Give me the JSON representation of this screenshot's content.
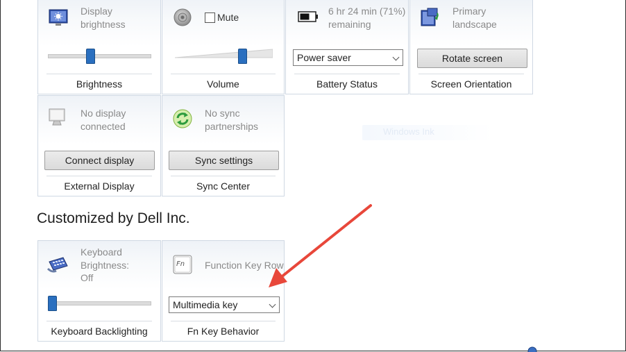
{
  "tiles": {
    "brightness": {
      "status_line1": "Display",
      "status_line2": "brightness",
      "caption": "Brightness",
      "slider_level": 0.41
    },
    "volume": {
      "mute_label": "Mute",
      "mute_checked": false,
      "caption": "Volume",
      "slider_level": 0.7
    },
    "battery": {
      "status_line1": "6 hr 24 min (71%)",
      "status_line2": "remaining",
      "dropdown_value": "Power saver",
      "caption": "Battery Status"
    },
    "orientation": {
      "status_line1": "Primary",
      "status_line2": "landscape",
      "button_label": "Rotate screen",
      "caption": "Screen Orientation"
    },
    "external_display": {
      "status_line1": "No display",
      "status_line2": "connected",
      "button_label": "Connect display",
      "caption": "External Display"
    },
    "sync_center": {
      "status_line1": "No sync",
      "status_line2": "partnerships",
      "button_label": "Sync settings",
      "caption": "Sync Center"
    },
    "keyboard_backlight": {
      "status_line1": "Keyboard",
      "status_line2": "Brightness:",
      "status_line3": "Off",
      "caption": "Keyboard Backlighting",
      "slider_level": 0.0
    },
    "fn_key": {
      "status_line1": "Function Key Row",
      "dropdown_value": "Multimedia key",
      "caption": "Fn Key Behavior"
    }
  },
  "section": {
    "title": "Customized by Dell Inc."
  },
  "ghost_text": "Windows Ink",
  "annotation": {
    "color": "#e8473a"
  },
  "icons": {
    "brightness": "display-brightness-icon",
    "volume": "speaker-icon",
    "battery": "battery-icon",
    "orientation": "rotate-display-icon",
    "external_display": "monitor-icon",
    "sync_center": "sync-icon",
    "keyboard_backlight": "keyboard-icon",
    "fn_key": "fn-key-icon"
  }
}
